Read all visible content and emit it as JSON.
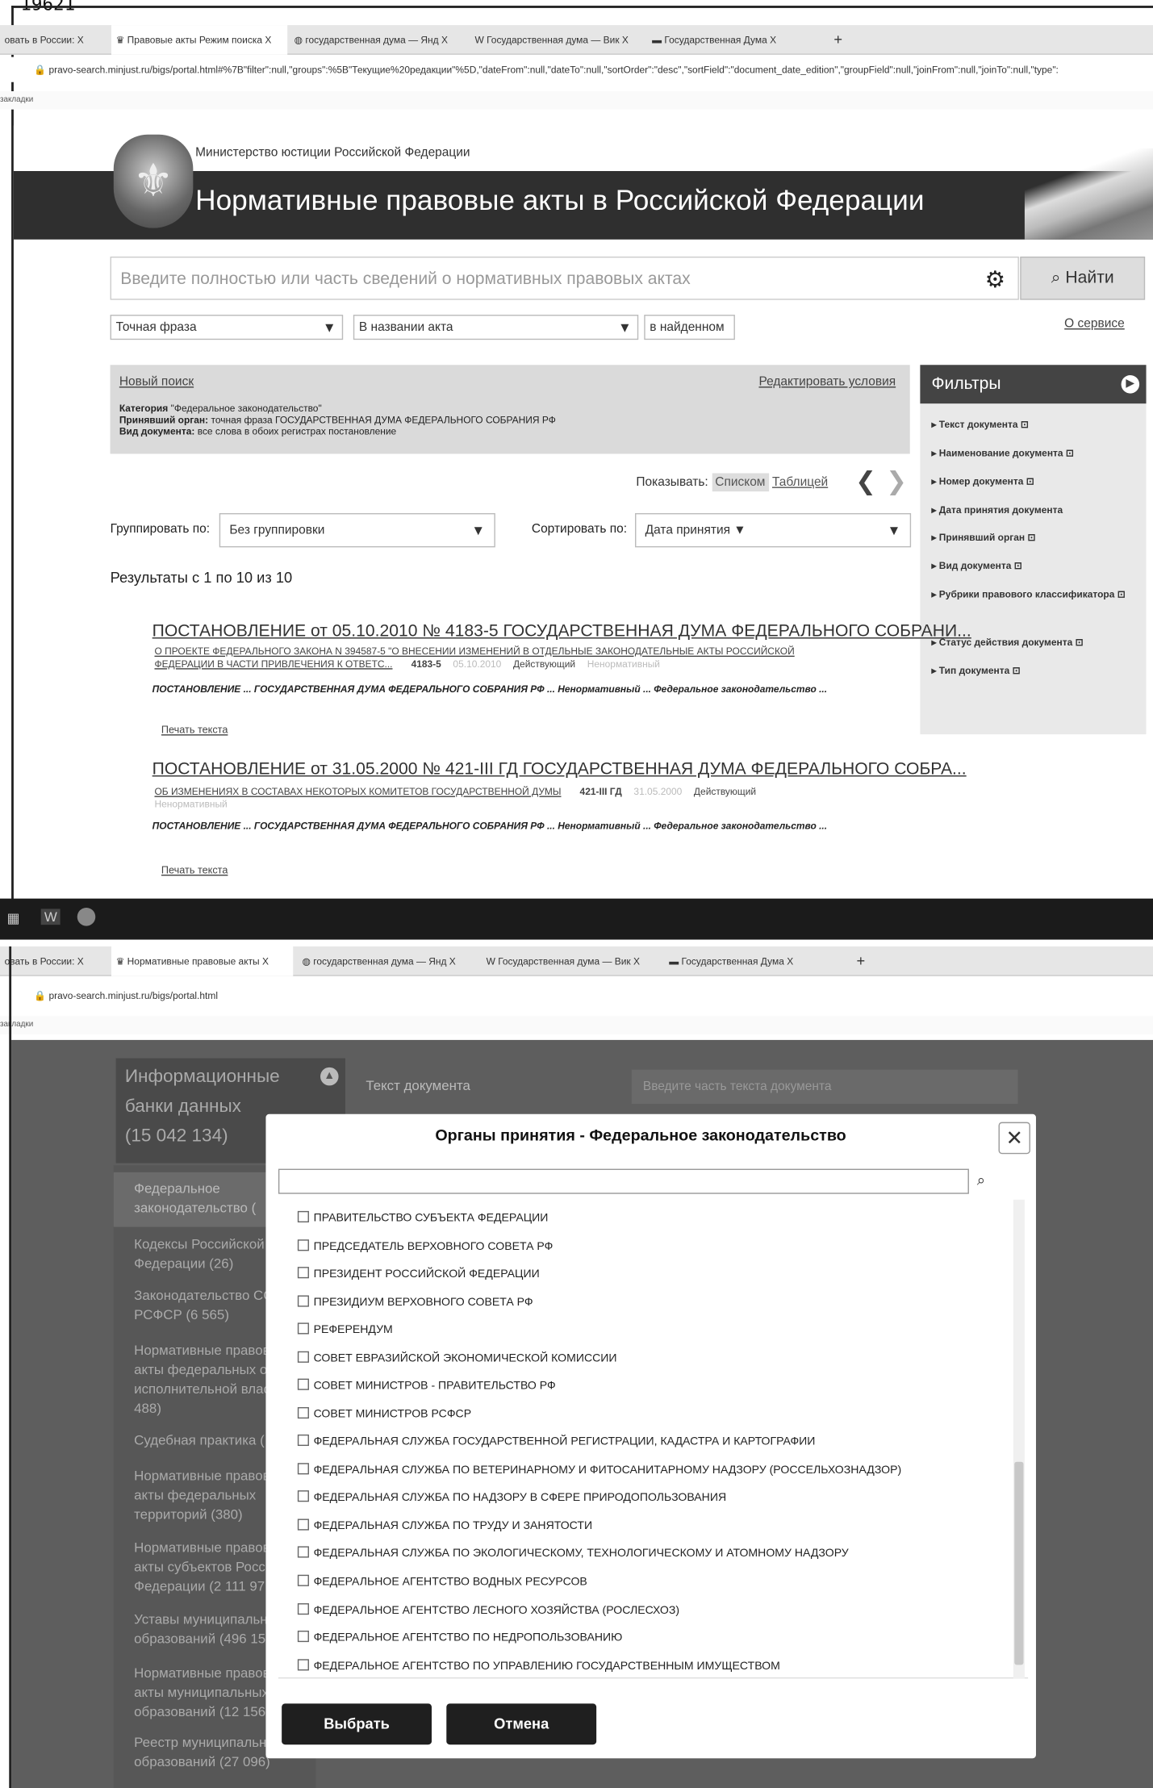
{
  "page_number": "19621",
  "top": {
    "tabs": [
      "овать в России: X",
      "Правовые акты Режим поиска X",
      "государственная дума — Янд X",
      "W Государственная дума — Вик X",
      "Государственная Дума X"
    ],
    "url": "pravo-search.minjust.ru/bigs/portal.html#%7B\"filter\":null,\"groups\":%5B\"Текущие%20редакции\"%5D,\"dateFrom\":null,\"dateTo\":null,\"sortOrder\":\"desc\",\"sortField\":\"document_date_edition\",\"groupField\":null,\"joinFrom\":null,\"joinTo\":null,\"type\":",
    "bookmarks": "закладки",
    "ministry": "Министерство юстиции Российской Федерации",
    "site_title": "Нормативные правовые акты в Российской Федерации",
    "search_placeholder": "Введите полностью или часть сведений о нормативных правовых актах",
    "search_button": "Найти",
    "match_mode": "Точная фраза",
    "search_scope": "В названии акта",
    "in_found": "в найденном",
    "about": "О сервисе",
    "new_search": "Новый поиск",
    "edit_conditions": "Редактировать условия",
    "criteria": [
      {
        "label": "Категория",
        "value": "\"Федеральное законодательство\""
      },
      {
        "label": "Принявший орган:",
        "value": "точная фраза ГОСУДАРСТВЕННАЯ ДУМА ФЕДЕРАЛЬНОГО СОБРАНИЯ РФ"
      },
      {
        "label": "Вид документа:",
        "value": "все слова в обоих регистрах постановление"
      }
    ],
    "show_label": "Показывать:",
    "show_list": "Списком",
    "show_table": "Таблицей",
    "group_label": "Группировать по:",
    "group_value": "Без группировки",
    "sort_label": "Сортировать по:",
    "sort_value": "Дата принятия ▼",
    "results_count": "Результаты с 1 по 10 из 10",
    "filters_title": "Фильтры",
    "filters": [
      "Текст документа",
      "Наименование документа",
      "Номер документа",
      "Дата принятия документа",
      "Принявший орган",
      "Вид документа",
      "Рубрики правового классификатора",
      "Статус действия документа",
      "Тип документа"
    ],
    "results": [
      {
        "title": "ПОСТАНОВЛЕНИЕ от 05.10.2010 № 4183-5 ГОСУДАРСТВЕННАЯ ДУМА ФЕДЕРАЛЬНОГО СОБРАНИ...",
        "desc1": "О ПРОЕКТЕ ФЕДЕРАЛЬНОГО ЗАКОНА N 394587-5 \"О ВНЕСЕНИИ ИЗМЕНЕНИЙ В ОТДЕЛЬНЫЕ ЗАКОНОДАТЕЛЬНЫЕ АКТЫ РОССИЙСКОЙ",
        "desc2": "ФЕДЕРАЦИИ В ЧАСТИ ПРИВЛЕЧЕНИЯ К ОТВЕТС...",
        "number": "4183-5",
        "date": "05.10.2010",
        "status": "Действующий",
        "kind": "Ненормативный",
        "meta": "ПОСТАНОВЛЕНИЕ ... ГОСУДАРСТВЕННАЯ ДУМА ФЕДЕРАЛЬНОГО СОБРАНИЯ РФ ... Ненормативный ... Федеральное законодательство ...",
        "print": "Печать текста"
      },
      {
        "title": "ПОСТАНОВЛЕНИЕ от 31.05.2000 № 421-III ГД ГОСУДАРСТВЕННАЯ ДУМА ФЕДЕРАЛЬНОГО СОБРА...",
        "desc1": "ОБ ИЗМЕНЕНИЯХ В СОСТАВАХ НЕКОТОРЫХ КОМИТЕТОВ ГОСУДАРСТВЕННОЙ ДУМЫ",
        "number": "421-III ГД",
        "date": "31.05.2000",
        "status": "Действующий",
        "kind": "Ненормативный",
        "meta": "ПОСТАНОВЛЕНИЕ ... ГОСУДАРСТВЕННАЯ ДУМА ФЕДЕРАЛЬНОГО СОБРАНИЯ РФ ... Ненормативный ... Федеральное законодательство ...",
        "print": "Печать текста"
      }
    ]
  },
  "bottom": {
    "tabs": [
      "овать в России: X",
      "Нормативные правовые акты X",
      "государственная дума — Янд X",
      "W Государственная дума — Вик X",
      "Государственная Дума X"
    ],
    "url": "pravo-search.minjust.ru/bigs/portal.html",
    "bookmarks": "закладки",
    "sidebar_title": "Информационные банки данных",
    "sidebar_count": "(15 042 134)",
    "sidebar_items": [
      "Федеральное законодательство (",
      "Кодексы Российской Федерации (26)",
      "Законодательство СССР, РСФСР (6 565)",
      "Нормативные правовые акты федеральных органов исполнительной власти (74 488)",
      "Судебная практика (",
      "Нормативные правовые акты федеральных территорий (380)",
      "Нормативные правовые акты субъектов Российской Федерации (2 111 97",
      "Уставы муниципальных образований (496 15",
      "Нормативные правовые акты муниципальных образований (12 156 760)",
      "Реестр муниципальных образований (27 096)"
    ],
    "bg_label": "Текст документа",
    "bg_placeholder": "Введите часть текста документа",
    "modal_title": "Органы принятия - Федеральное законодательство",
    "options": [
      "ПРАВИТЕЛЬСТВО СУБЪЕКТА ФЕДЕРАЦИИ",
      "ПРЕДСЕДАТЕЛЬ ВЕРХОВНОГО СОВЕТА РФ",
      "ПРЕЗИДЕНТ РОССИЙСКОЙ ФЕДЕРАЦИИ",
      "ПРЕЗИДИУМ ВЕРХОВНОГО СОВЕТА РФ",
      "РЕФЕРЕНДУМ",
      "СОВЕТ ЕВРАЗИЙСКОЙ ЭКОНОМИЧЕСКОЙ КОМИССИИ",
      "СОВЕТ МИНИСТРОВ - ПРАВИТЕЛЬСТВО РФ",
      "СОВЕТ МИНИСТРОВ РСФСР",
      "ФЕДЕРАЛЬНАЯ СЛУЖБА ГОСУДАРСТВЕННОЙ РЕГИСТРАЦИИ, КАДАСТРА И КАРТОГРАФИИ",
      "ФЕДЕРАЛЬНАЯ СЛУЖБА ПО ВЕТЕРИНАРНОМУ И ФИТОСАНИТАРНОМУ НАДЗОРУ (РОССЕЛЬХОЗНАДЗОР)",
      "ФЕДЕРАЛЬНАЯ СЛУЖБА ПО НАДЗОРУ В СФЕРЕ ПРИРОДОПОЛЬЗОВАНИЯ",
      "ФЕДЕРАЛЬНАЯ СЛУЖБА ПО ТРУДУ И ЗАНЯТОСТИ",
      "ФЕДЕРАЛЬНАЯ СЛУЖБА ПО ЭКОЛОГИЧЕСКОМУ, ТЕХНОЛОГИЧЕСКОМУ И АТОМНОМУ НАДЗОРУ",
      "ФЕДЕРАЛЬНОЕ АГЕНТСТВО ВОДНЫХ РЕСУРСОВ",
      "ФЕДЕРАЛЬНОЕ АГЕНТСТВО ЛЕСНОГО ХОЗЯЙСТВА (РОСЛЕСХОЗ)",
      "ФЕДЕРАЛЬНОЕ АГЕНТСТВО ПО НЕДРОПОЛЬЗОВАНИЮ",
      "ФЕДЕРАЛЬНОЕ АГЕНТСТВО ПО УПРАВЛЕНИЮ ГОСУДАРСТВЕННЫМ ИМУЩЕСТВОМ"
    ],
    "select_button": "Выбрать",
    "cancel_button": "Отмена"
  }
}
